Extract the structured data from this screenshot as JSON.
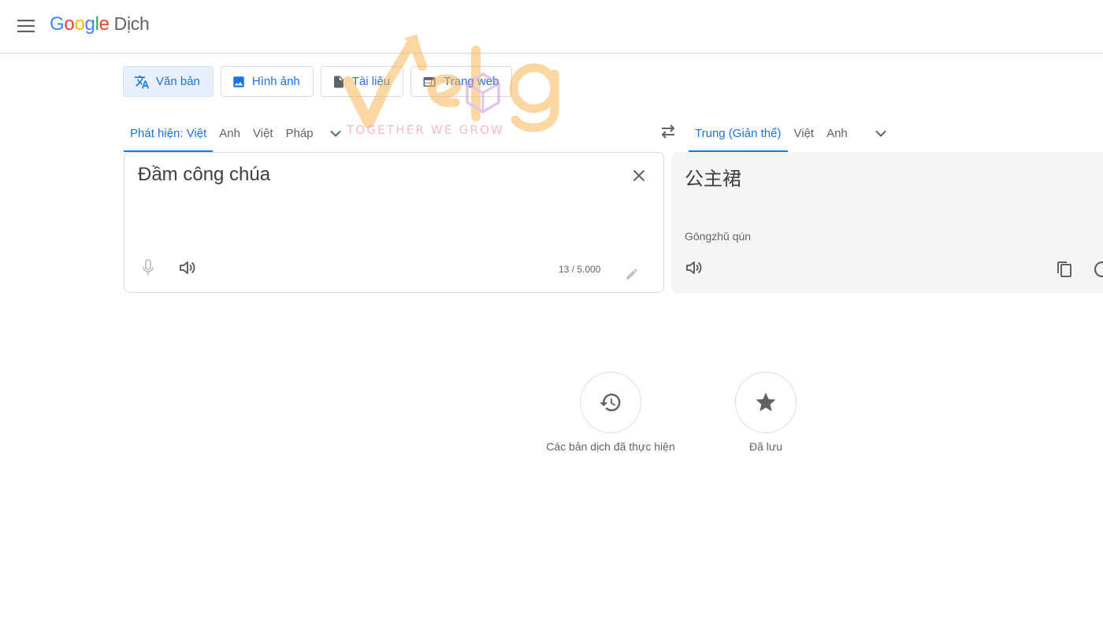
{
  "header": {
    "logo_letters": [
      {
        "char": "G",
        "color": "#4285f4"
      },
      {
        "char": "o",
        "color": "#ea4335"
      },
      {
        "char": "o",
        "color": "#fbbc05"
      },
      {
        "char": "g",
        "color": "#4285f4"
      },
      {
        "char": "l",
        "color": "#34a853"
      },
      {
        "char": "e",
        "color": "#ea4335"
      }
    ],
    "product_name": "Dịch",
    "menu_icon": "hamburger-menu-icon"
  },
  "modes": [
    {
      "label": "Văn bản",
      "icon": "translate-icon",
      "active": true
    },
    {
      "label": "Hình ảnh",
      "icon": "image-icon",
      "active": false
    },
    {
      "label": "Tài liệu",
      "icon": "document-icon",
      "active": false
    },
    {
      "label": "Trang web",
      "icon": "web-icon",
      "active": false
    }
  ],
  "source_langs": [
    {
      "label": "Phát hiện: Việt",
      "active": true
    },
    {
      "label": "Anh",
      "active": false
    },
    {
      "label": "Việt",
      "active": false
    },
    {
      "label": "Pháp",
      "active": false
    }
  ],
  "target_langs": [
    {
      "label": "Trung (Giản thể)",
      "active": true
    },
    {
      "label": "Việt",
      "active": false
    },
    {
      "label": "Anh",
      "active": false
    }
  ],
  "source": {
    "text": "Đầm công chúa",
    "char_count": "13 / 5.000"
  },
  "target": {
    "text": "公主裙",
    "romanization": "Gōngzhǔ qún"
  },
  "quick_actions": {
    "history_label": "Các bản dịch đã thực hiện",
    "saved_label": "Đã lưu"
  },
  "watermark": {
    "tagline": "TOGETHER WE GROW"
  },
  "colors": {
    "accent": "#1a73e8",
    "active_mode_bg": "#e8f0fe",
    "target_panel_bg": "#f5f5f5",
    "icon_gray": "#5f6368"
  }
}
